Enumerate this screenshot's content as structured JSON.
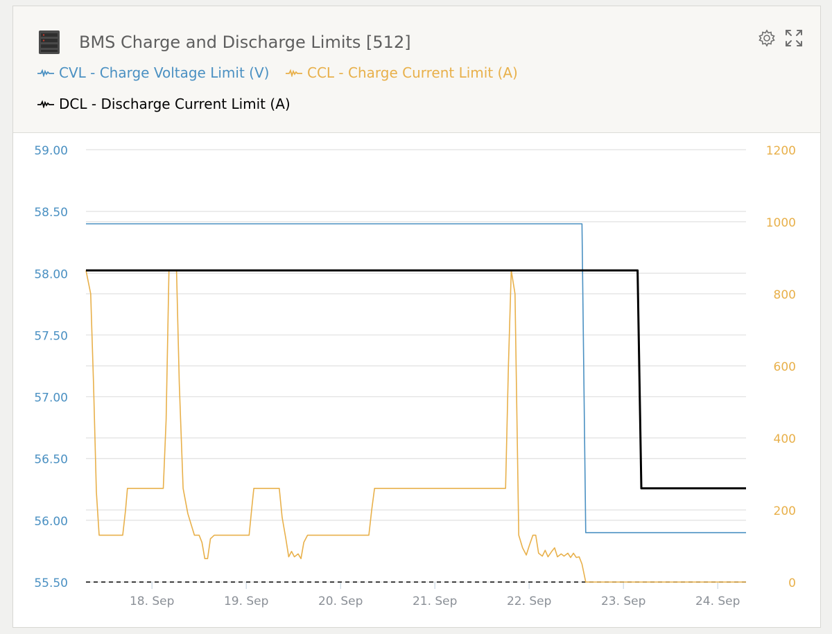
{
  "header": {
    "title": "BMS Charge and Discharge Limits [512]",
    "icons": [
      "battery-device-icon",
      "gear-icon",
      "expand-icon"
    ]
  },
  "legend": [
    {
      "label": "CVL - Charge Voltage Limit (V)",
      "color": "#4a90c2"
    },
    {
      "label": "CCL - Charge Current Limit (A)",
      "color": "#e8b04a"
    },
    {
      "label": "DCL - Discharge Current Limit (A)",
      "color": "#000000"
    }
  ],
  "chart_data": {
    "type": "line",
    "x_unit": "days (September)",
    "xlim": [
      17.3,
      24.3
    ],
    "xticks": [
      {
        "v": 18,
        "label": "18. Sep"
      },
      {
        "v": 19,
        "label": "19. Sep"
      },
      {
        "v": 20,
        "label": "20. Sep"
      },
      {
        "v": 21,
        "label": "21. Sep"
      },
      {
        "v": 22,
        "label": "22. Sep"
      },
      {
        "v": 23,
        "label": "23. Sep"
      },
      {
        "v": 24,
        "label": "24. Sep"
      }
    ],
    "y_left": {
      "ylim": [
        55.5,
        59.0
      ],
      "ticks": [
        {
          "v": 55.5,
          "label": "55.50"
        },
        {
          "v": 56.0,
          "label": "56.00"
        },
        {
          "v": 56.5,
          "label": "56.50"
        },
        {
          "v": 57.0,
          "label": "57.00"
        },
        {
          "v": 57.5,
          "label": "57.50"
        },
        {
          "v": 58.0,
          "label": "58.00"
        },
        {
          "v": 58.5,
          "label": "58.50"
        },
        {
          "v": 59.0,
          "label": "59.00"
        }
      ],
      "color": "#4a90c2"
    },
    "y_right": {
      "ylim": [
        0,
        1200
      ],
      "ticks": [
        {
          "v": 0,
          "label": "0"
        },
        {
          "v": 200,
          "label": "200"
        },
        {
          "v": 400,
          "label": "400"
        },
        {
          "v": 600,
          "label": "600"
        },
        {
          "v": 800,
          "label": "800"
        },
        {
          "v": 1000,
          "label": "1000"
        },
        {
          "v": 1200,
          "label": "1200"
        }
      ],
      "color": "#e8b04a"
    },
    "series": [
      {
        "name": "CVL - Charge Voltage Limit (V)",
        "axis": "left",
        "color": "#4a90c2",
        "points": [
          [
            17.3,
            58.4
          ],
          [
            22.56,
            58.4
          ],
          [
            22.6,
            55.9
          ],
          [
            24.3,
            55.9
          ]
        ]
      },
      {
        "name": "CCL - Charge Current Limit (A)",
        "axis": "right",
        "color": "#e8b04a",
        "points": [
          [
            17.3,
            865
          ],
          [
            17.35,
            800
          ],
          [
            17.38,
            550
          ],
          [
            17.41,
            250
          ],
          [
            17.44,
            130
          ],
          [
            17.69,
            130
          ],
          [
            17.72,
            200
          ],
          [
            17.74,
            260
          ],
          [
            18.12,
            260
          ],
          [
            18.15,
            450
          ],
          [
            18.18,
            865
          ],
          [
            18.26,
            865
          ],
          [
            18.29,
            550
          ],
          [
            18.33,
            260
          ],
          [
            18.38,
            190
          ],
          [
            18.45,
            130
          ],
          [
            18.5,
            130
          ],
          [
            18.53,
            110
          ],
          [
            18.56,
            65
          ],
          [
            18.59,
            65
          ],
          [
            18.62,
            120
          ],
          [
            18.66,
            130
          ],
          [
            19.03,
            130
          ],
          [
            19.06,
            210
          ],
          [
            19.08,
            260
          ],
          [
            19.35,
            260
          ],
          [
            19.38,
            180
          ],
          [
            19.42,
            120
          ],
          [
            19.45,
            70
          ],
          [
            19.48,
            85
          ],
          [
            19.51,
            70
          ],
          [
            19.55,
            78
          ],
          [
            19.58,
            65
          ],
          [
            19.61,
            110
          ],
          [
            19.65,
            130
          ],
          [
            20.3,
            130
          ],
          [
            20.33,
            200
          ],
          [
            20.36,
            260
          ],
          [
            21.75,
            260
          ],
          [
            21.78,
            600
          ],
          [
            21.81,
            865
          ],
          [
            21.85,
            800
          ],
          [
            21.89,
            130
          ],
          [
            21.93,
            95
          ],
          [
            21.97,
            75
          ],
          [
            22.0,
            100
          ],
          [
            22.04,
            130
          ],
          [
            22.07,
            130
          ],
          [
            22.1,
            80
          ],
          [
            22.14,
            72
          ],
          [
            22.17,
            88
          ],
          [
            22.2,
            70
          ],
          [
            22.24,
            85
          ],
          [
            22.27,
            95
          ],
          [
            22.3,
            70
          ],
          [
            22.34,
            78
          ],
          [
            22.37,
            72
          ],
          [
            22.41,
            80
          ],
          [
            22.44,
            68
          ],
          [
            22.47,
            80
          ],
          [
            22.5,
            68
          ],
          [
            22.53,
            70
          ],
          [
            22.56,
            50
          ],
          [
            22.6,
            0
          ],
          [
            24.3,
            0
          ]
        ]
      },
      {
        "name": "DCL - Discharge Current Limit (A)",
        "axis": "right",
        "color": "#000000",
        "points": [
          [
            17.3,
            865
          ],
          [
            23.15,
            865
          ],
          [
            23.19,
            260
          ],
          [
            24.3,
            260
          ]
        ]
      }
    ],
    "reference_lines": [
      {
        "axis": "right",
        "y": 0,
        "style": "dashed",
        "color": "#000000"
      }
    ],
    "grid": true
  }
}
